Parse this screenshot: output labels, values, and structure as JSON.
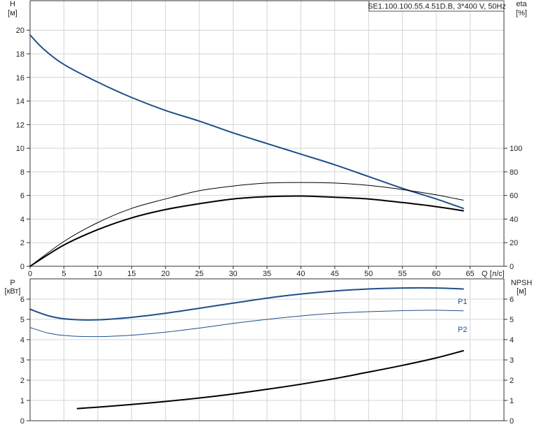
{
  "chart_data": [
    {
      "type": "line",
      "title": "SE1.100.100.55.4.51D.B, 3*400 V, 50Hz",
      "xlabel": "Q [л/с]",
      "ylabel_left": "H",
      "ylabel_left_unit": "[м]",
      "ylabel_right": "eta",
      "ylabel_right_unit": "[%]",
      "xlim": [
        0,
        70
      ],
      "ylim_left": [
        0,
        22.5
      ],
      "ylim_right": [
        0,
        225
      ],
      "x_ticks": [
        0,
        5,
        10,
        15,
        20,
        25,
        30,
        35,
        40,
        45,
        50,
        55,
        60,
        65
      ],
      "y_ticks_left": [
        0,
        2,
        4,
        6,
        8,
        10,
        12,
        14,
        16,
        18,
        20
      ],
      "y_ticks_right": [
        0,
        20,
        40,
        60,
        80,
        100
      ],
      "grid": true,
      "series": [
        {
          "axis": "left",
          "color": "#1f4f8b",
          "width": 2,
          "x": [
            0,
            2,
            5,
            10,
            15,
            20,
            25,
            30,
            35,
            40,
            45,
            50,
            55,
            60,
            64
          ],
          "y": [
            19.6,
            18.4,
            17.1,
            15.6,
            14.3,
            13.2,
            12.3,
            11.3,
            10.4,
            9.5,
            8.6,
            7.6,
            6.6,
            5.7,
            4.9
          ]
        },
        {
          "axis": "right",
          "color": "#000000",
          "width": 1,
          "x": [
            0,
            5,
            10,
            15,
            20,
            25,
            30,
            35,
            40,
            45,
            50,
            55,
            60,
            64
          ],
          "y": [
            0,
            21,
            37,
            49,
            57,
            64,
            68,
            70.5,
            71,
            70.5,
            68.5,
            65,
            60.5,
            56
          ]
        },
        {
          "axis": "right",
          "color": "#000000",
          "width": 2,
          "x": [
            0,
            5,
            10,
            15,
            20,
            25,
            30,
            35,
            40,
            45,
            50,
            55,
            60,
            64
          ],
          "y": [
            0,
            18,
            31,
            41,
            48,
            53,
            57,
            59,
            59.5,
            58.5,
            57,
            54,
            50.5,
            47
          ]
        }
      ]
    },
    {
      "type": "line",
      "xlabel": "",
      "ylabel_left": "P",
      "ylabel_left_unit": "[кВт]",
      "ylabel_right": "NPSH",
      "ylabel_right_unit": "[м]",
      "xlim": [
        0,
        70
      ],
      "ylim_left": [
        0,
        7
      ],
      "ylim_right": [
        0,
        7
      ],
      "y_ticks_left": [
        0,
        1,
        2,
        3,
        4,
        5,
        6
      ],
      "y_ticks_right": [
        0,
        1,
        2,
        3,
        4,
        5,
        6
      ],
      "grid": true,
      "series": [
        {
          "name": "P1",
          "axis": "left",
          "color": "#1f4f8b",
          "width": 2,
          "x": [
            0,
            3,
            6,
            10,
            15,
            20,
            25,
            30,
            35,
            40,
            45,
            50,
            55,
            60,
            64
          ],
          "y": [
            5.5,
            5.15,
            5.0,
            4.98,
            5.1,
            5.3,
            5.55,
            5.8,
            6.05,
            6.25,
            6.4,
            6.5,
            6.55,
            6.55,
            6.5
          ]
        },
        {
          "name": "P2",
          "axis": "left",
          "color": "#1f4f8b",
          "width": 1,
          "x": [
            0,
            3,
            6,
            10,
            15,
            20,
            25,
            30,
            35,
            40,
            45,
            50,
            55,
            60,
            64
          ],
          "y": [
            4.6,
            4.3,
            4.18,
            4.15,
            4.22,
            4.37,
            4.57,
            4.8,
            5.0,
            5.17,
            5.3,
            5.38,
            5.43,
            5.45,
            5.42
          ]
        },
        {
          "axis": "right",
          "color": "#000000",
          "width": 2,
          "x": [
            7,
            10,
            15,
            20,
            25,
            30,
            35,
            40,
            45,
            50,
            55,
            60,
            64
          ],
          "y": [
            0.6,
            0.67,
            0.8,
            0.95,
            1.12,
            1.32,
            1.55,
            1.8,
            2.08,
            2.4,
            2.73,
            3.1,
            3.45
          ]
        }
      ]
    }
  ]
}
